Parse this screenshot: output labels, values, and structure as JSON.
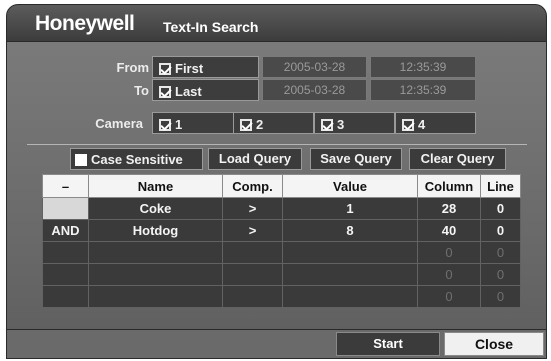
{
  "window": {
    "brand": "Honeywell",
    "title": "Text-In Search"
  },
  "range": {
    "from_label": "From",
    "to_label": "To",
    "first_label": "First",
    "last_label": "Last",
    "from_date": "2005-03-28",
    "from_time": "12:35:39",
    "to_date": "2005-03-28",
    "to_time": "12:35:39"
  },
  "camera": {
    "label": "Camera",
    "items": [
      "1",
      "2",
      "3",
      "4"
    ]
  },
  "options": {
    "case_sensitive": "Case Sensitive",
    "load_query": "Load Query",
    "save_query": "Save Query",
    "clear_query": "Clear Query"
  },
  "grid": {
    "headers": [
      "–",
      "Name",
      "Comp.",
      "Value",
      "Column",
      "Line"
    ],
    "rows": [
      [
        "",
        "Coke",
        ">",
        "1",
        "28",
        "0"
      ],
      [
        "AND",
        "Hotdog",
        ">",
        "8",
        "40",
        "0"
      ],
      [
        "",
        "",
        "",
        "",
        "0",
        "0"
      ],
      [
        "",
        "",
        "",
        "",
        "0",
        "0"
      ],
      [
        "",
        "",
        "",
        "",
        "0",
        "0"
      ]
    ]
  },
  "actions": {
    "start": "Start",
    "close": "Close"
  }
}
